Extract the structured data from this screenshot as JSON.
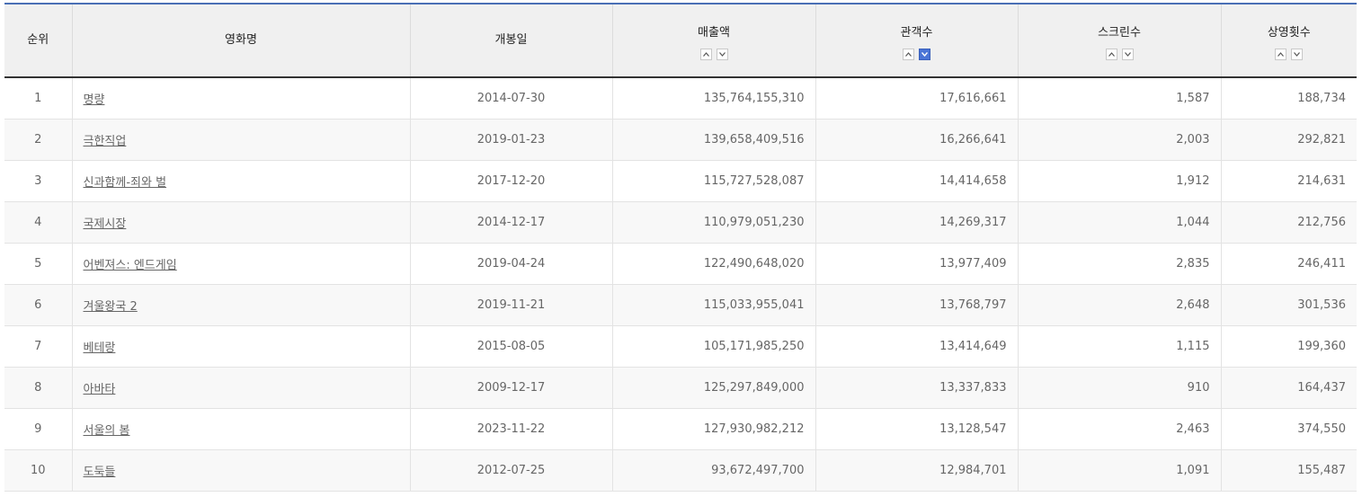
{
  "columns": {
    "rank": "순위",
    "title": "영화명",
    "release": "개봉일",
    "sales": "매출액",
    "audience": "관객수",
    "screens": "스크린수",
    "showings": "상영횟수"
  },
  "sort": {
    "active_column": "audience",
    "active_direction": "desc",
    "accent_color": "#4a74d6"
  },
  "icons": {
    "sort_up": "chevron-up-icon",
    "sort_down": "chevron-down-icon"
  },
  "rows": [
    {
      "rank": "1",
      "title": "명량",
      "release": "2014-07-30",
      "sales": "135,764,155,310",
      "audience": "17,616,661",
      "screens": "1,587",
      "showings": "188,734"
    },
    {
      "rank": "2",
      "title": "극한직업",
      "release": "2019-01-23",
      "sales": "139,658,409,516",
      "audience": "16,266,641",
      "screens": "2,003",
      "showings": "292,821"
    },
    {
      "rank": "3",
      "title": "신과함께-죄와 벌",
      "release": "2017-12-20",
      "sales": "115,727,528,087",
      "audience": "14,414,658",
      "screens": "1,912",
      "showings": "214,631"
    },
    {
      "rank": "4",
      "title": "국제시장",
      "release": "2014-12-17",
      "sales": "110,979,051,230",
      "audience": "14,269,317",
      "screens": "1,044",
      "showings": "212,756"
    },
    {
      "rank": "5",
      "title": "어벤져스: 엔드게임",
      "release": "2019-04-24",
      "sales": "122,490,648,020",
      "audience": "13,977,409",
      "screens": "2,835",
      "showings": "246,411"
    },
    {
      "rank": "6",
      "title": "겨울왕국 2",
      "release": "2019-11-21",
      "sales": "115,033,955,041",
      "audience": "13,768,797",
      "screens": "2,648",
      "showings": "301,536"
    },
    {
      "rank": "7",
      "title": "베테랑",
      "release": "2015-08-05",
      "sales": "105,171,985,250",
      "audience": "13,414,649",
      "screens": "1,115",
      "showings": "199,360"
    },
    {
      "rank": "8",
      "title": "아바타",
      "release": "2009-12-17",
      "sales": "125,297,849,000",
      "audience": "13,337,833",
      "screens": "910",
      "showings": "164,437"
    },
    {
      "rank": "9",
      "title": "서울의 봄",
      "release": "2023-11-22",
      "sales": "127,930,982,212",
      "audience": "13,128,547",
      "screens": "2,463",
      "showings": "374,550"
    },
    {
      "rank": "10",
      "title": "도둑들",
      "release": "2012-07-25",
      "sales": "93,672,497,700",
      "audience": "12,984,701",
      "screens": "1,091",
      "showings": "155,487"
    }
  ]
}
